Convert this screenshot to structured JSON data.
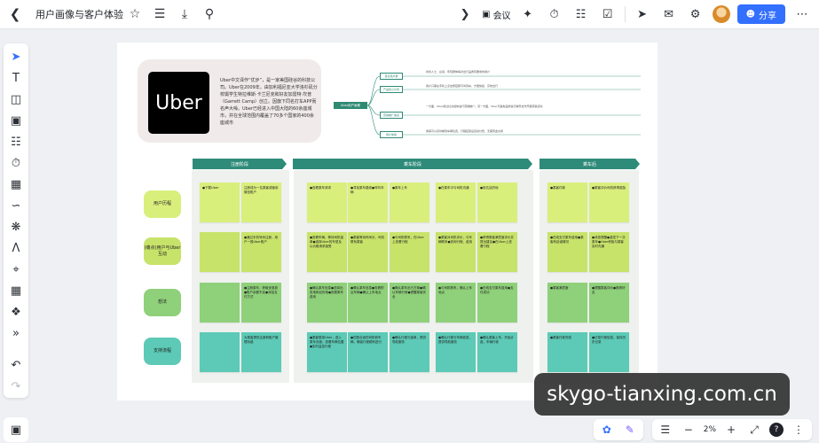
{
  "topbar": {
    "title": "用户画像与客户体验",
    "meeting_label": "会议",
    "share_label": "分享"
  },
  "header": {
    "logo_text": "Uber",
    "intro": "Uber中文译作“优步”，是一家美国硅谷的科技公司。Uber在2009年，由加利福尼亚大学洛杉矶分校辍学生特拉维斯·卡兰尼克和好友加雷特·坎普（Garrett Camp）创立。因旗下同名打车APP而名声大噪。Uber已经进入中国大陆的60余座城市，并在全球范围内覆盖了70多个国家的400余座城市"
  },
  "mindmap": {
    "root": "Uber用户画像",
    "nodes": [
      "目标用户群",
      "产品核心价值",
      "营销推广渠道",
      "用户体验"
    ],
    "details": [
      "商务人士、白领、年轻群体等对出行品质有要求的用户",
      "用户只需在手机上点击按钮即可叫到车，方便快捷、高效出行",
      "一方面，Uber通过社交媒体进行营销推广；另一方面，Uber与各类品牌进行跨界合作开展营销活动",
      "乘客可以实时看到车辆位置，行程结束后自动付费，无需现金交易"
    ]
  },
  "journey": {
    "phases": [
      "注册阶段",
      "乘车阶段",
      "乘车后"
    ],
    "rows": [
      "用户历程",
      "(痛点)用户与Uber互动",
      "想法",
      "支持流程"
    ]
  },
  "notes": [
    [
      "●下载Uber",
      "注册成为一名乘客或使用微信账户",
      "●查看乘车请求",
      "●寻找乘车路线●呼叫车辆",
      "●乘车上车",
      "●在乘车中与司机沟通",
      "●到达目的地",
      "●乘客付款",
      "●乘客评价司机获得奖励"
    ],
    [
      "",
      "●通过手机号码注册，用户一般Uber账户",
      "●查看车辆，等待司机接单●选择Uber的车型及以价格请求接受",
      "●乘客等待时间长，司机联系乘客",
      "●与司机联系，在Uber上查看行程",
      "●乘客对司机评价，与车辆联系●查询行程、费用",
      "●获得乘客满意度评价并提出建议●在Uber上查看行程",
      "●在线支付乘车费用●乘客有延误情况",
      "●消息提醒●激发下一次乘车●Uber积极与乘客实时沟通"
    ],
    [
      "",
      "●注册乘车，获取优惠券●账户余额不足●添加支付方式",
      "●确认乘车信息●选择出发地和目的地●查看乘车费用",
      "●确认乘车信息●查看附近车辆●确认上车地点",
      "●确认乘车出行方案●确认车辆行驶●提醒乘客安全",
      "●与司机联系，确认上车地点",
      "●在线支付乘车费用●支付成功",
      "●乘客满意度",
      "●提醒乘客评价●推荐好友"
    ],
    [
      "",
      "为乘客提供注册和账户管理功能",
      "●乘客登录Uber，进入乘车页面，查看车辆位置●实时监控行程",
      "●匹配合适的司机和车辆，确保行程顺利进行",
      "●确认行程与接单，提供导航服务",
      "●确认行程与车辆信息，提供导航服务",
      "●确认乘客上车，开始计费，车辆行驶",
      "●乘客付款完成",
      "●记录行程信息，保存历史记录"
    ]
  ],
  "bottombar": {
    "zoom": "2%"
  },
  "watermark": "skygo-tianxing.com.cn",
  "colors": {
    "accent": "#3370ff",
    "phase": "#2f8b79",
    "row_yellow": "#d9ef7c",
    "row_lime": "#c8e36a",
    "row_green": "#8fd07a",
    "row_teal": "#5ccab6"
  }
}
